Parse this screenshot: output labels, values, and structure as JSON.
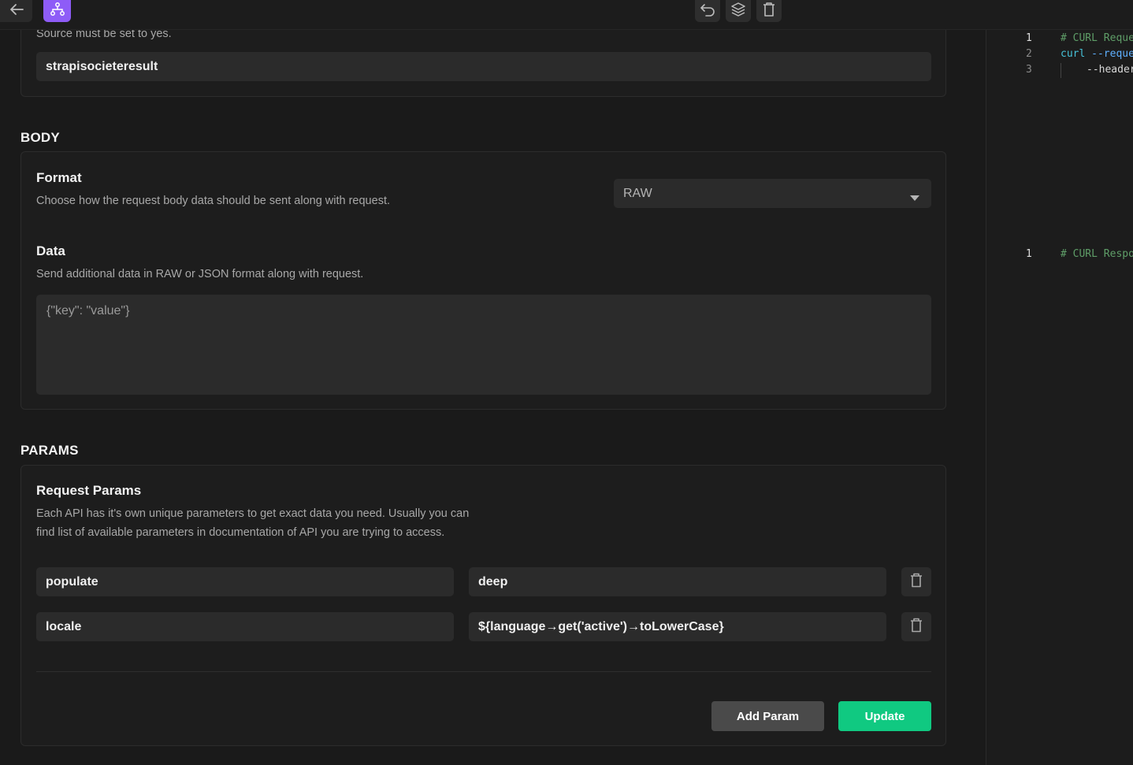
{
  "colors": {
    "accent_purple": "#8e5cf7",
    "update_green": "#10c981",
    "add_param_gray": "#4a4a4a",
    "code_comment": "#5f9e68",
    "code_keyword": "#46c2d8",
    "code_flag": "#5fb0ff"
  },
  "toolbar": {
    "back_icon": "arrow-left-icon",
    "brand_icon": "workflow-icon",
    "undo_icon": "undo-icon",
    "layers_icon": "layers-icon",
    "delete_icon": "trash-icon"
  },
  "source_section": {
    "description": "Source must be set to yes.",
    "value": "strapisocieteresult"
  },
  "body_section": {
    "heading": "BODY",
    "format": {
      "title": "Format",
      "description": "Choose how the request body data should be sent along with request.",
      "selected": "RAW"
    },
    "data": {
      "title": "Data",
      "description": "Send additional data in RAW or JSON format along with request.",
      "placeholder": "{\"key\": \"value\"}"
    }
  },
  "params_section": {
    "heading": "PARAMS",
    "title": "Request Params",
    "description_line1": "Each API has it's own unique parameters to get exact data you need. Usually you can",
    "description_line2": "find list of available parameters in documentation of API you are trying to access.",
    "rows": [
      {
        "key": "populate",
        "value": "deep"
      },
      {
        "key": "locale",
        "value": "${language→get('active')→toLowerCase}"
      }
    ],
    "add_label": "Add Param",
    "update_label": "Update"
  },
  "code_panel": {
    "request_lines": [
      {
        "num": "1",
        "text": "# CURL Reque"
      },
      {
        "num": "2",
        "keyword": "curl",
        "flag": "--reque"
      },
      {
        "num": "3",
        "text": "--header"
      }
    ],
    "response_lines": [
      {
        "num": "1",
        "text": "# CURL Respo"
      }
    ]
  }
}
